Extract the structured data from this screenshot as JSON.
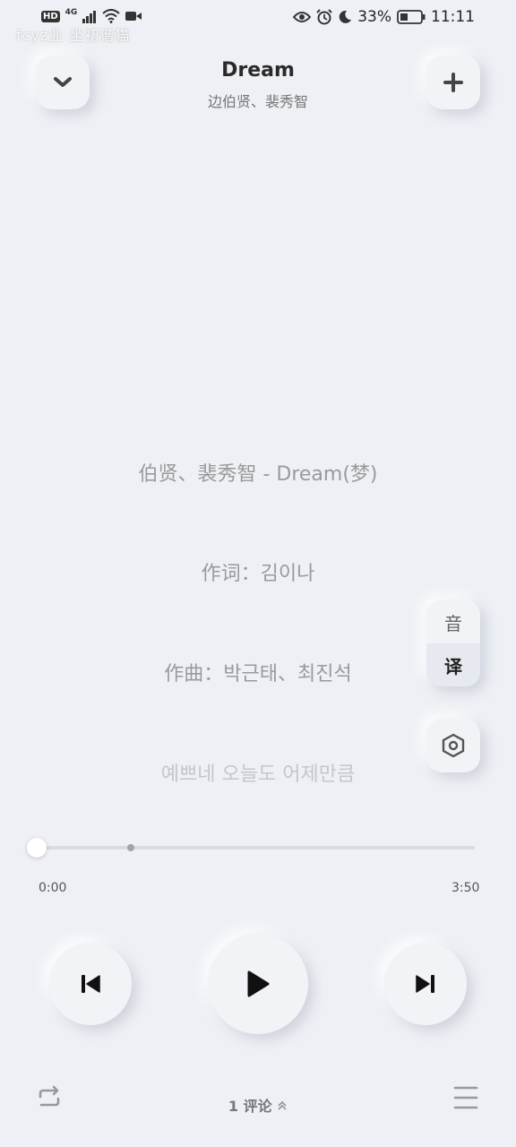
{
  "status_bar": {
    "hd": "HD",
    "network": "4G",
    "battery_percent": "33%",
    "time": "11:11",
    "watermark": "fcyz业 坐初谐猫"
  },
  "header": {
    "title": "Dream",
    "subtitle": "边伯贤、裴秀智"
  },
  "lyrics": [
    "伯贤、裴秀智 - Dream(梦)",
    "作词：김이나",
    "作曲：박근태、최진석",
    "예쁘네 오늘도 어제만큼"
  ],
  "side_panel": {
    "top_label": "音",
    "bottom_label": "译"
  },
  "player": {
    "current_time": "0:00",
    "total_time": "3:50",
    "progress": 0.0
  },
  "footer": {
    "comment_count": "1",
    "comment_label": "评论"
  },
  "colors": {
    "background": "#eef0f5",
    "icon": "#222222",
    "muted": "#9a9a9a"
  }
}
